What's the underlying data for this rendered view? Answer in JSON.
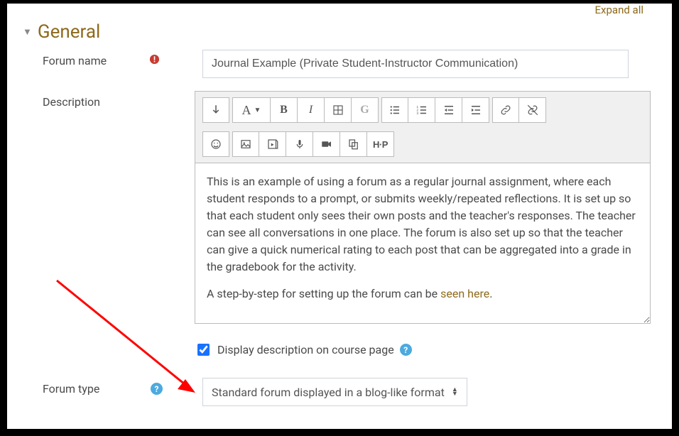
{
  "header": {
    "expand_all": "Expand all",
    "section_title": "General"
  },
  "fields": {
    "forum_name": {
      "label": "Forum name",
      "value": "Journal Example (Private Student-Instructor Communication)"
    },
    "description": {
      "label": "Description",
      "content_main": "This is an example of using a forum as a regular journal assignment, where each student responds to a prompt, or submits weekly/repeated reflections. It is set up so that each student only sees their own posts and the teacher's responses. The teacher can see all conversations in one place. The forum is also set up so that the teacher can give a quick numerical rating to each post that can be aggregated into a grade in the gradebook for the activity.",
      "content_step_prefix": "A step-by-step for setting up the forum can be ",
      "content_step_link": "seen here",
      "content_step_suffix": "."
    },
    "display_description": {
      "label": "Display description on course page",
      "checked": true
    },
    "forum_type": {
      "label": "Forum type",
      "value": "Standard forum displayed in a blog-like format"
    }
  },
  "toolbar": {
    "collapse": "↓",
    "font": "A",
    "bold": "B",
    "italic": "I",
    "grade": "G",
    "h5p": "H-P"
  }
}
